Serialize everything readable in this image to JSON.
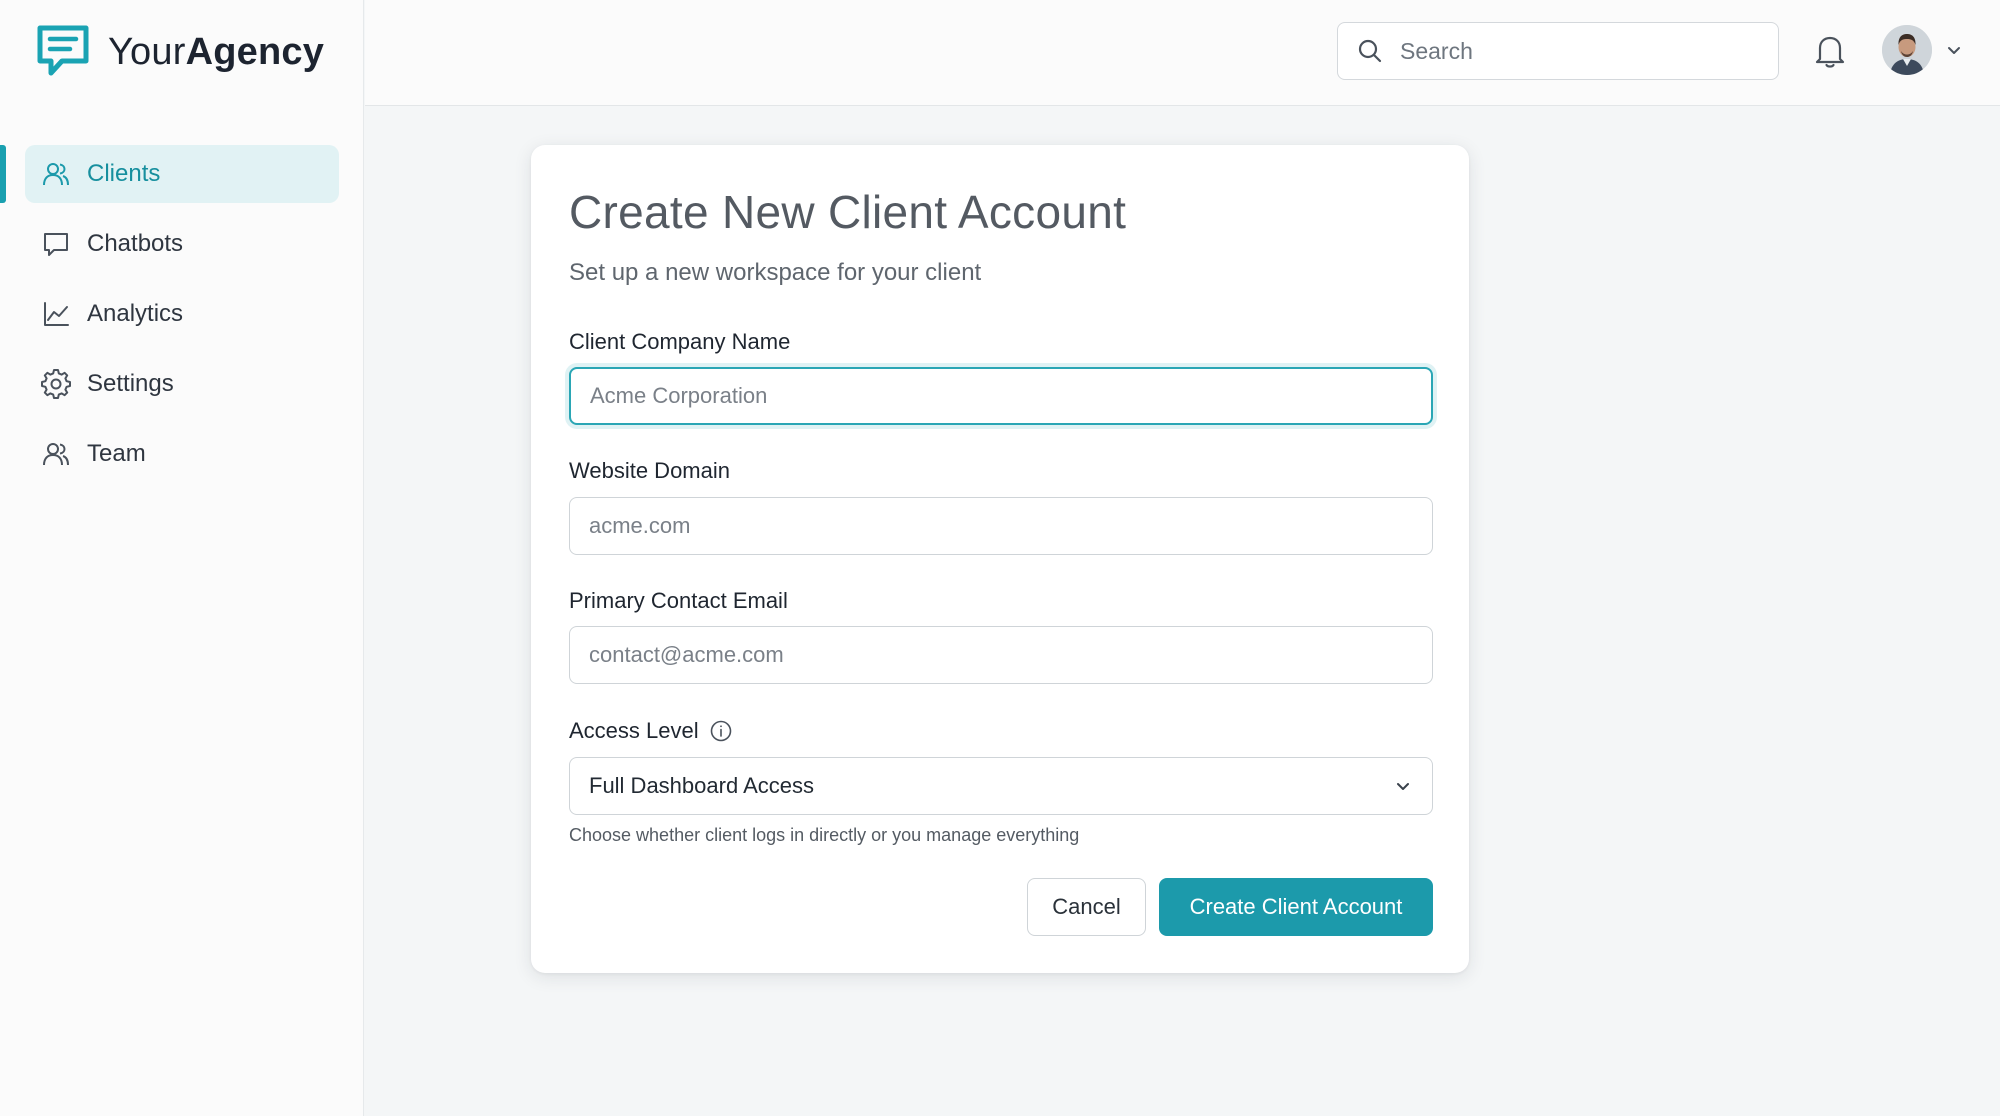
{
  "brand": {
    "name_light": "Your",
    "name_bold": "Agency",
    "accent_color": "#1c9aab"
  },
  "sidebar": {
    "items": [
      {
        "label": "Clients",
        "icon": "users-icon",
        "active": true
      },
      {
        "label": "Chatbots",
        "icon": "chat-bubble-icon",
        "active": false
      },
      {
        "label": "Analytics",
        "icon": "line-chart-icon",
        "active": false
      },
      {
        "label": "Settings",
        "icon": "gear-icon",
        "active": false
      },
      {
        "label": "Team",
        "icon": "team-icon",
        "active": false
      }
    ]
  },
  "header": {
    "search_placeholder": "Search",
    "notifications_icon": "bell-icon",
    "avatar_icon": "user-avatar"
  },
  "form": {
    "title": "Create New Client Account",
    "subtitle": "Set up a new workspace for your client",
    "company": {
      "label": "Client Company Name",
      "placeholder": "Acme Corporation",
      "value": ""
    },
    "domain": {
      "label": "Website Domain",
      "placeholder": "acme.com",
      "value": ""
    },
    "email": {
      "label": "Primary Contact Email",
      "placeholder": "contact@acme.com",
      "value": ""
    },
    "access": {
      "label": "Access Level",
      "selected": "Full Dashboard Access",
      "helper": "Choose whether client logs in directly or you manage everything"
    },
    "cancel_label": "Cancel",
    "submit_label": "Create Client Account"
  }
}
